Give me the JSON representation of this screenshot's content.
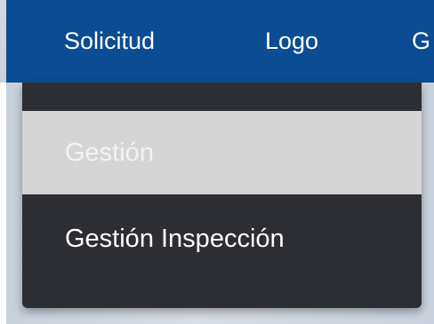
{
  "navbar": {
    "items": [
      {
        "label": "Solicitud"
      },
      {
        "label": "Logo"
      },
      {
        "label": "G"
      }
    ]
  },
  "dropdown": {
    "items": [
      {
        "label": "Gestión",
        "state": "hovered"
      },
      {
        "label": "Gestión Inspección"
      }
    ]
  },
  "colors": {
    "navbar": "#0c4c92",
    "dropdown_bg": "#2d2e33",
    "hover_bg": "#d5d5d6",
    "text": "#ffffff"
  }
}
